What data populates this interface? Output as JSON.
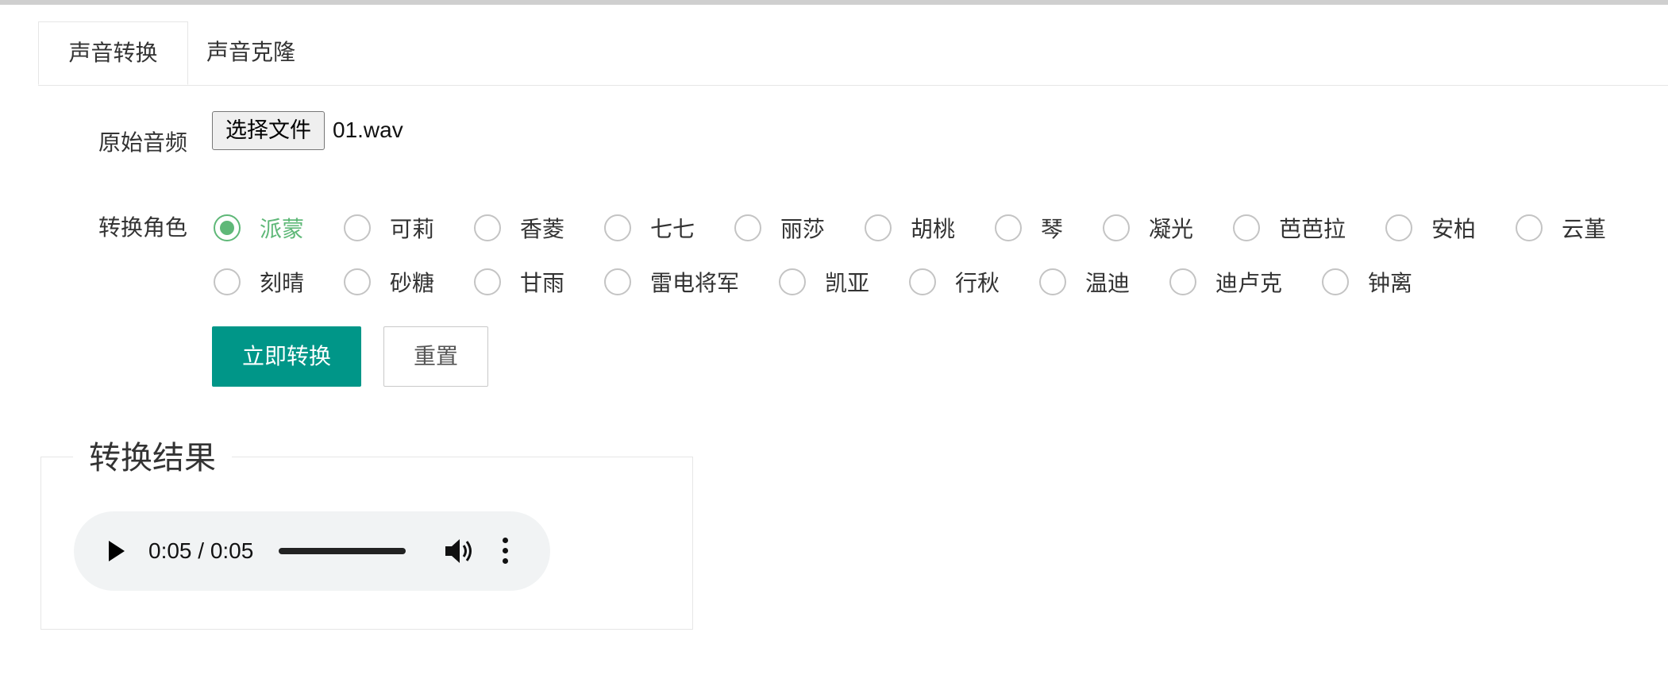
{
  "tabs": [
    {
      "label": "声音转换",
      "active": true
    },
    {
      "label": "声音克隆",
      "active": false
    }
  ],
  "form": {
    "source_audio_label": "原始音频",
    "file_button_label": "选择文件",
    "file_name": "01.wav",
    "role_label": "转换角色",
    "roles": [
      "派蒙",
      "可莉",
      "香菱",
      "七七",
      "丽莎",
      "胡桃",
      "琴",
      "凝光",
      "芭芭拉",
      "安柏",
      "云堇",
      "刻晴",
      "砂糖",
      "甘雨",
      "雷电将军",
      "凯亚",
      "行秋",
      "温迪",
      "迪卢克",
      "钟离"
    ],
    "selected_role": "派蒙",
    "submit_label": "立即转换",
    "reset_label": "重置"
  },
  "result": {
    "title": "转换结果",
    "time_display": "0:05 / 0:05",
    "progress_fraction": 1.0
  },
  "colors": {
    "accent": "#009688",
    "radio_checked": "#5fb878"
  },
  "icons": {
    "play": "play-icon",
    "volume": "volume-icon",
    "more": "more-vert-icon"
  }
}
